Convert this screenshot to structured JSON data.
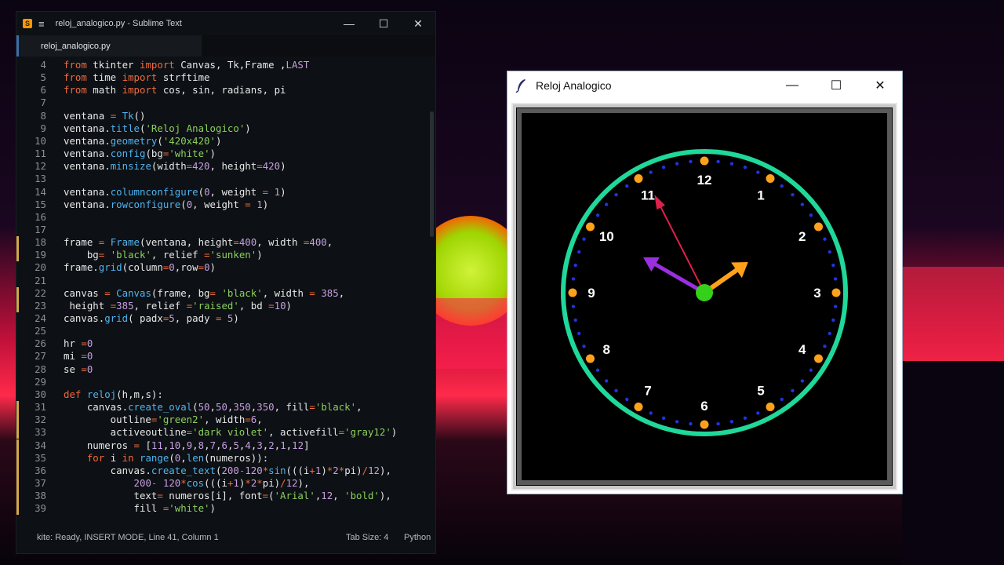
{
  "sublime": {
    "window_title": "reloj_analogico.py - Sublime Text",
    "tab_label": "reloj_analogico.py",
    "status_left": "Line 41, Column 1",
    "status_left_prefix": "kite: Ready, INSERT MODE,",
    "tab_size": "Tab Size: 4",
    "syntax": "Python",
    "lines": [
      {
        "n": "4",
        "tokens": [
          [
            "kw",
            "from"
          ],
          [
            "op",
            " tkinter "
          ],
          [
            "kw",
            "import"
          ],
          [
            "op",
            " Canvas, Tk,Frame ,"
          ],
          [
            "num",
            "LAST"
          ]
        ]
      },
      {
        "n": "5",
        "tokens": [
          [
            "kw",
            "from"
          ],
          [
            "op",
            " time "
          ],
          [
            "kw",
            "import"
          ],
          [
            "op",
            " strftime"
          ]
        ]
      },
      {
        "n": "6",
        "tokens": [
          [
            "kw",
            "from"
          ],
          [
            "op",
            " math "
          ],
          [
            "kw",
            "import"
          ],
          [
            "op",
            " cos, sin, radians, pi"
          ]
        ]
      },
      {
        "n": "7",
        "tokens": []
      },
      {
        "n": "8",
        "tokens": [
          [
            "op",
            "ventana "
          ],
          [
            "kw",
            "="
          ],
          [
            "op",
            " "
          ],
          [
            "fn",
            "Tk"
          ],
          [
            "op",
            "()"
          ]
        ]
      },
      {
        "n": "9",
        "tokens": [
          [
            "op",
            "ventana."
          ],
          [
            "fn",
            "title"
          ],
          [
            "op",
            "("
          ],
          [
            "str",
            "'Reloj Analogico'"
          ],
          [
            "op",
            ")"
          ]
        ]
      },
      {
        "n": "10",
        "tokens": [
          [
            "op",
            "ventana."
          ],
          [
            "fn",
            "geometry"
          ],
          [
            "op",
            "("
          ],
          [
            "str",
            "'420x420'"
          ],
          [
            "op",
            ")"
          ]
        ]
      },
      {
        "n": "11",
        "tokens": [
          [
            "op",
            "ventana."
          ],
          [
            "fn",
            "config"
          ],
          [
            "op",
            "(bg"
          ],
          [
            "kw",
            "="
          ],
          [
            "str",
            "'white'"
          ],
          [
            "op",
            ")"
          ]
        ]
      },
      {
        "n": "12",
        "tokens": [
          [
            "op",
            "ventana."
          ],
          [
            "fn",
            "minsize"
          ],
          [
            "op",
            "(width"
          ],
          [
            "kw",
            "="
          ],
          [
            "num",
            "420"
          ],
          [
            "op",
            ", height"
          ],
          [
            "kw",
            "="
          ],
          [
            "num",
            "420"
          ],
          [
            "op",
            ")"
          ]
        ]
      },
      {
        "n": "13",
        "tokens": []
      },
      {
        "n": "14",
        "tokens": [
          [
            "op",
            "ventana."
          ],
          [
            "fn",
            "columnconfigure"
          ],
          [
            "op",
            "("
          ],
          [
            "num",
            "0"
          ],
          [
            "op",
            ", weight "
          ],
          [
            "kw",
            "="
          ],
          [
            "op",
            " "
          ],
          [
            "num",
            "1"
          ],
          [
            "op",
            ")"
          ]
        ]
      },
      {
        "n": "15",
        "tokens": [
          [
            "op",
            "ventana."
          ],
          [
            "fn",
            "rowconfigure"
          ],
          [
            "op",
            "("
          ],
          [
            "num",
            "0"
          ],
          [
            "op",
            ", weight "
          ],
          [
            "kw",
            "="
          ],
          [
            "op",
            " "
          ],
          [
            "num",
            "1"
          ],
          [
            "op",
            ")"
          ]
        ]
      },
      {
        "n": "16",
        "tokens": []
      },
      {
        "n": "17",
        "tokens": []
      },
      {
        "n": "18",
        "tokens": [
          [
            "op",
            "frame "
          ],
          [
            "kw",
            "="
          ],
          [
            "op",
            " "
          ],
          [
            "fn",
            "Frame"
          ],
          [
            "op",
            "(ventana, height"
          ],
          [
            "kw",
            "="
          ],
          [
            "num",
            "400"
          ],
          [
            "op",
            ", width "
          ],
          [
            "kw",
            "="
          ],
          [
            "num",
            "400"
          ],
          [
            "op",
            ","
          ]
        ]
      },
      {
        "n": "19",
        "tokens": [
          [
            "op",
            "    bg"
          ],
          [
            "kw",
            "="
          ],
          [
            "op",
            " "
          ],
          [
            "str",
            "'black'"
          ],
          [
            "op",
            ", relief "
          ],
          [
            "kw",
            "="
          ],
          [
            "str",
            "'sunken'"
          ],
          [
            "op",
            ")"
          ]
        ]
      },
      {
        "n": "20",
        "tokens": [
          [
            "op",
            "frame."
          ],
          [
            "fn",
            "grid"
          ],
          [
            "op",
            "(column"
          ],
          [
            "kw",
            "="
          ],
          [
            "num",
            "0"
          ],
          [
            "op",
            ",row"
          ],
          [
            "kw",
            "="
          ],
          [
            "num",
            "0"
          ],
          [
            "op",
            ")"
          ]
        ]
      },
      {
        "n": "21",
        "tokens": []
      },
      {
        "n": "22",
        "tokens": [
          [
            "op",
            "canvas "
          ],
          [
            "kw",
            "="
          ],
          [
            "op",
            " "
          ],
          [
            "fn",
            "Canvas"
          ],
          [
            "op",
            "(frame, bg"
          ],
          [
            "kw",
            "="
          ],
          [
            "op",
            " "
          ],
          [
            "str",
            "'black'"
          ],
          [
            "op",
            ", width "
          ],
          [
            "kw",
            "="
          ],
          [
            "op",
            " "
          ],
          [
            "num",
            "385"
          ],
          [
            "op",
            ","
          ]
        ]
      },
      {
        "n": "23",
        "tokens": [
          [
            "op",
            " height "
          ],
          [
            "kw",
            "="
          ],
          [
            "num",
            "385"
          ],
          [
            "op",
            ", relief "
          ],
          [
            "kw",
            "="
          ],
          [
            "str",
            "'raised'"
          ],
          [
            "op",
            ", bd "
          ],
          [
            "kw",
            "="
          ],
          [
            "num",
            "10"
          ],
          [
            "op",
            ")"
          ]
        ]
      },
      {
        "n": "24",
        "tokens": [
          [
            "op",
            "canvas."
          ],
          [
            "fn",
            "grid"
          ],
          [
            "op",
            "( padx"
          ],
          [
            "kw",
            "="
          ],
          [
            "num",
            "5"
          ],
          [
            "op",
            ", pady "
          ],
          [
            "kw",
            "="
          ],
          [
            "op",
            " "
          ],
          [
            "num",
            "5"
          ],
          [
            "op",
            ")"
          ]
        ]
      },
      {
        "n": "25",
        "tokens": []
      },
      {
        "n": "26",
        "tokens": [
          [
            "op",
            "hr "
          ],
          [
            "kw",
            "="
          ],
          [
            "num",
            "0"
          ]
        ]
      },
      {
        "n": "27",
        "tokens": [
          [
            "op",
            "mi "
          ],
          [
            "kw",
            "="
          ],
          [
            "num",
            "0"
          ]
        ]
      },
      {
        "n": "28",
        "tokens": [
          [
            "op",
            "se "
          ],
          [
            "kw",
            "="
          ],
          [
            "num",
            "0"
          ]
        ]
      },
      {
        "n": "29",
        "tokens": []
      },
      {
        "n": "30",
        "tokens": [
          [
            "kw",
            "def"
          ],
          [
            "op",
            " "
          ],
          [
            "fn",
            "reloj"
          ],
          [
            "op",
            "(h,m,s):"
          ]
        ]
      },
      {
        "n": "31",
        "tokens": [
          [
            "op",
            "    canvas."
          ],
          [
            "fn",
            "create_oval"
          ],
          [
            "op",
            "("
          ],
          [
            "num",
            "50"
          ],
          [
            "op",
            ","
          ],
          [
            "num",
            "50"
          ],
          [
            "op",
            ","
          ],
          [
            "num",
            "350"
          ],
          [
            "op",
            ","
          ],
          [
            "num",
            "350"
          ],
          [
            "op",
            ", fill"
          ],
          [
            "kw",
            "="
          ],
          [
            "str",
            "'black'"
          ],
          [
            "op",
            ","
          ]
        ]
      },
      {
        "n": "32",
        "tokens": [
          [
            "op",
            "        outline"
          ],
          [
            "kw",
            "="
          ],
          [
            "str",
            "'green2'"
          ],
          [
            "op",
            ", width"
          ],
          [
            "kw",
            "="
          ],
          [
            "num",
            "6"
          ],
          [
            "op",
            ","
          ]
        ]
      },
      {
        "n": "33",
        "tokens": [
          [
            "op",
            "        activeoutline"
          ],
          [
            "kw",
            "="
          ],
          [
            "str",
            "'dark violet'"
          ],
          [
            "op",
            ", activefill"
          ],
          [
            "kw",
            "="
          ],
          [
            "str",
            "'gray12'"
          ],
          [
            "op",
            ")"
          ]
        ]
      },
      {
        "n": "34",
        "tokens": [
          [
            "op",
            "    numeros "
          ],
          [
            "kw",
            "="
          ],
          [
            "op",
            " ["
          ],
          [
            "num",
            "11"
          ],
          [
            "op",
            ","
          ],
          [
            "num",
            "10"
          ],
          [
            "op",
            ","
          ],
          [
            "num",
            "9"
          ],
          [
            "op",
            ","
          ],
          [
            "num",
            "8"
          ],
          [
            "op",
            ","
          ],
          [
            "num",
            "7"
          ],
          [
            "op",
            ","
          ],
          [
            "num",
            "6"
          ],
          [
            "op",
            ","
          ],
          [
            "num",
            "5"
          ],
          [
            "op",
            ","
          ],
          [
            "num",
            "4"
          ],
          [
            "op",
            ","
          ],
          [
            "num",
            "3"
          ],
          [
            "op",
            ","
          ],
          [
            "num",
            "2"
          ],
          [
            "op",
            ","
          ],
          [
            "num",
            "1"
          ],
          [
            "op",
            ","
          ],
          [
            "num",
            "12"
          ],
          [
            "op",
            "]"
          ]
        ]
      },
      {
        "n": "35",
        "tokens": [
          [
            "op",
            "    "
          ],
          [
            "kw",
            "for"
          ],
          [
            "op",
            " i "
          ],
          [
            "kw",
            "in"
          ],
          [
            "op",
            " "
          ],
          [
            "fn",
            "range"
          ],
          [
            "op",
            "("
          ],
          [
            "num",
            "0"
          ],
          [
            "op",
            ","
          ],
          [
            "fn",
            "len"
          ],
          [
            "op",
            "(numeros)):"
          ]
        ]
      },
      {
        "n": "36",
        "tokens": [
          [
            "op",
            "        canvas."
          ],
          [
            "fn",
            "create_text"
          ],
          [
            "op",
            "("
          ],
          [
            "num",
            "200"
          ],
          [
            "kw",
            "-"
          ],
          [
            "num",
            "120"
          ],
          [
            "kw",
            "*"
          ],
          [
            "fn",
            "sin"
          ],
          [
            "op",
            "(((i"
          ],
          [
            "kw",
            "+"
          ],
          [
            "num",
            "1"
          ],
          [
            "op",
            ")"
          ],
          [
            "kw",
            "*"
          ],
          [
            "num",
            "2"
          ],
          [
            "kw",
            "*"
          ],
          [
            "op",
            "pi)"
          ],
          [
            "kw",
            "/"
          ],
          [
            "num",
            "12"
          ],
          [
            "op",
            "),"
          ]
        ]
      },
      {
        "n": "37",
        "tokens": [
          [
            "op",
            "            "
          ],
          [
            "num",
            "200"
          ],
          [
            "kw",
            "-"
          ],
          [
            "op",
            " "
          ],
          [
            "num",
            "120"
          ],
          [
            "kw",
            "*"
          ],
          [
            "fn",
            "cos"
          ],
          [
            "op",
            "(((i"
          ],
          [
            "kw",
            "+"
          ],
          [
            "num",
            "1"
          ],
          [
            "op",
            ")"
          ],
          [
            "kw",
            "*"
          ],
          [
            "num",
            "2"
          ],
          [
            "kw",
            "*"
          ],
          [
            "op",
            "pi)"
          ],
          [
            "kw",
            "/"
          ],
          [
            "num",
            "12"
          ],
          [
            "op",
            "),"
          ]
        ]
      },
      {
        "n": "38",
        "tokens": [
          [
            "op",
            "            text"
          ],
          [
            "kw",
            "="
          ],
          [
            "op",
            " numeros[i], font"
          ],
          [
            "kw",
            "="
          ],
          [
            "op",
            "("
          ],
          [
            "str",
            "'Arial'"
          ],
          [
            "op",
            ","
          ],
          [
            "num",
            "12"
          ],
          [
            "op",
            ", "
          ],
          [
            "str",
            "'bold'"
          ],
          [
            "op",
            "),"
          ]
        ]
      },
      {
        "n": "39",
        "tokens": [
          [
            "op",
            "            fill "
          ],
          [
            "kw",
            "="
          ],
          [
            "str",
            "'white'"
          ],
          [
            "op",
            ")"
          ]
        ]
      }
    ]
  },
  "clock_window": {
    "title": "Reloj Analogico",
    "numbers": [
      "12",
      "1",
      "2",
      "3",
      "4",
      "5",
      "6",
      "7",
      "8",
      "9",
      "10",
      "11"
    ],
    "colors": {
      "ring": "#1fd89a",
      "minute_dots": "#2233dd",
      "hour_dots": "#ffa21a",
      "hour_hand": "#ffa21a",
      "minute_hand": "#9a2fe0",
      "second_hand": "#e0204a",
      "center": "#33d11a",
      "numbers": "#ffffff"
    },
    "time": {
      "hour": 12,
      "minute": 50,
      "second": 58
    }
  }
}
